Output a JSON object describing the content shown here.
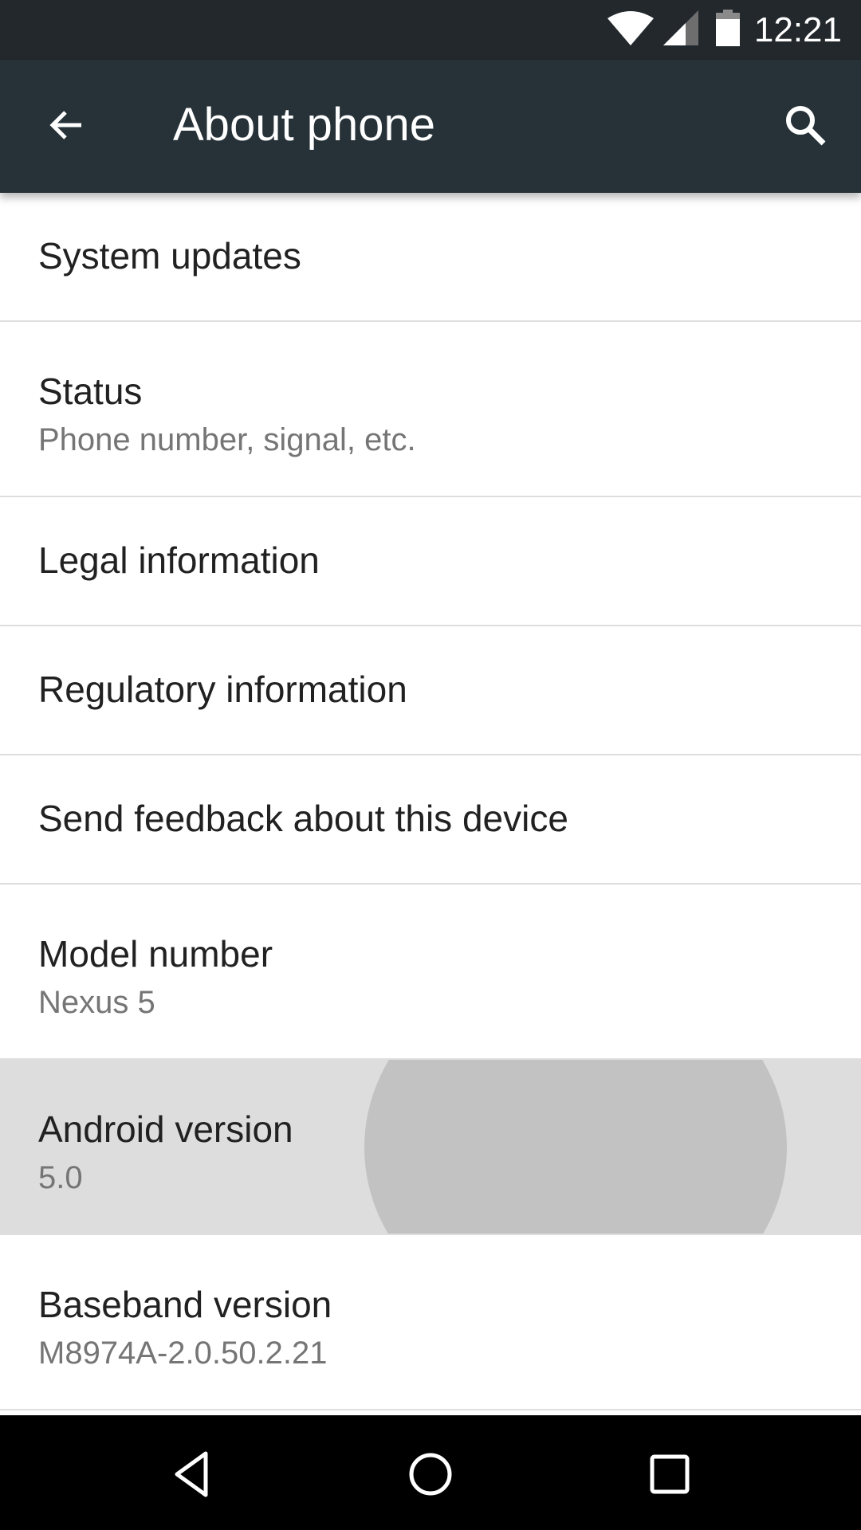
{
  "status_bar": {
    "time": "12:21",
    "icons": [
      "wifi-icon",
      "cell-signal-icon",
      "battery-icon"
    ]
  },
  "toolbar": {
    "back_icon": "arrow-left-icon",
    "title": "About phone",
    "search_icon": "search-icon",
    "background_color": "#263238"
  },
  "settings": {
    "items": [
      {
        "title": "System updates"
      },
      {
        "title": "Status",
        "summary": "Phone number, signal, etc."
      },
      {
        "title": "Legal information"
      },
      {
        "title": "Regulatory information"
      },
      {
        "title": "Send feedback about this device"
      },
      {
        "title": "Model number",
        "summary": "Nexus 5"
      },
      {
        "title": "Android version",
        "summary": "5.0",
        "pressed": true
      },
      {
        "title": "Baseband version",
        "summary": "M8974A-2.0.50.2.21"
      }
    ]
  },
  "nav_bar": {
    "buttons": [
      "back-triangle-icon",
      "home-circle-icon",
      "recents-square-icon"
    ]
  }
}
